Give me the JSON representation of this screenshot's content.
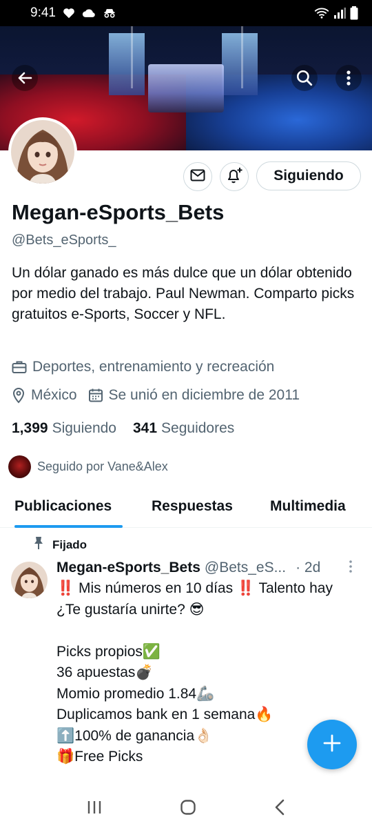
{
  "status_bar": {
    "time": "9:41"
  },
  "profile": {
    "display_name": "Megan-eSports_Bets",
    "handle": "@Bets_eSports_",
    "bio": "Un dólar ganado es más dulce que un dólar obtenido por medio del trabajo. Paul Newman. Comparto picks gratuitos e-Sports, Soccer y NFL.",
    "category": "Deportes, entrenamiento y recreación",
    "location": "México",
    "joined": "Se unió en diciembre de 2011",
    "following_count": "1,399",
    "following_label": "Siguiendo",
    "followers_count": "341",
    "followers_label": "Seguidores",
    "followed_by": "Seguido por Vane&Alex",
    "follow_button": "Siguiendo"
  },
  "tabs": [
    {
      "label": "Publicaciones",
      "active": true
    },
    {
      "label": "Respuestas",
      "active": false
    },
    {
      "label": "Multimedia",
      "active": false
    }
  ],
  "pinned_post": {
    "pinned_label": "Fijado",
    "author_name": "Megan-eSports_Bets",
    "author_handle": "@Bets_eS...",
    "time": "· 2d",
    "text": "‼️ Mis números en 10 días ‼️ Talento hay\n¿Te gustaría unirte? 😎\n\nPicks propios✅\n36 apuestas💣\nMomio promedio 1.84🦾\nDuplicamos bank en 1 semana🔥\n⬆️100% de ganancia👌🏻\n🎁Free Picks"
  },
  "colors": {
    "accent": "#1d9bf0",
    "text": "#0f1419",
    "secondary_text": "#536471",
    "border": "#cfd9de"
  },
  "icons": [
    "back-arrow-icon",
    "search-icon",
    "more-vertical-icon",
    "mail-icon",
    "bell-plus-icon",
    "briefcase-icon",
    "location-pin-icon",
    "calendar-icon",
    "pin-icon",
    "plus-icon"
  ]
}
